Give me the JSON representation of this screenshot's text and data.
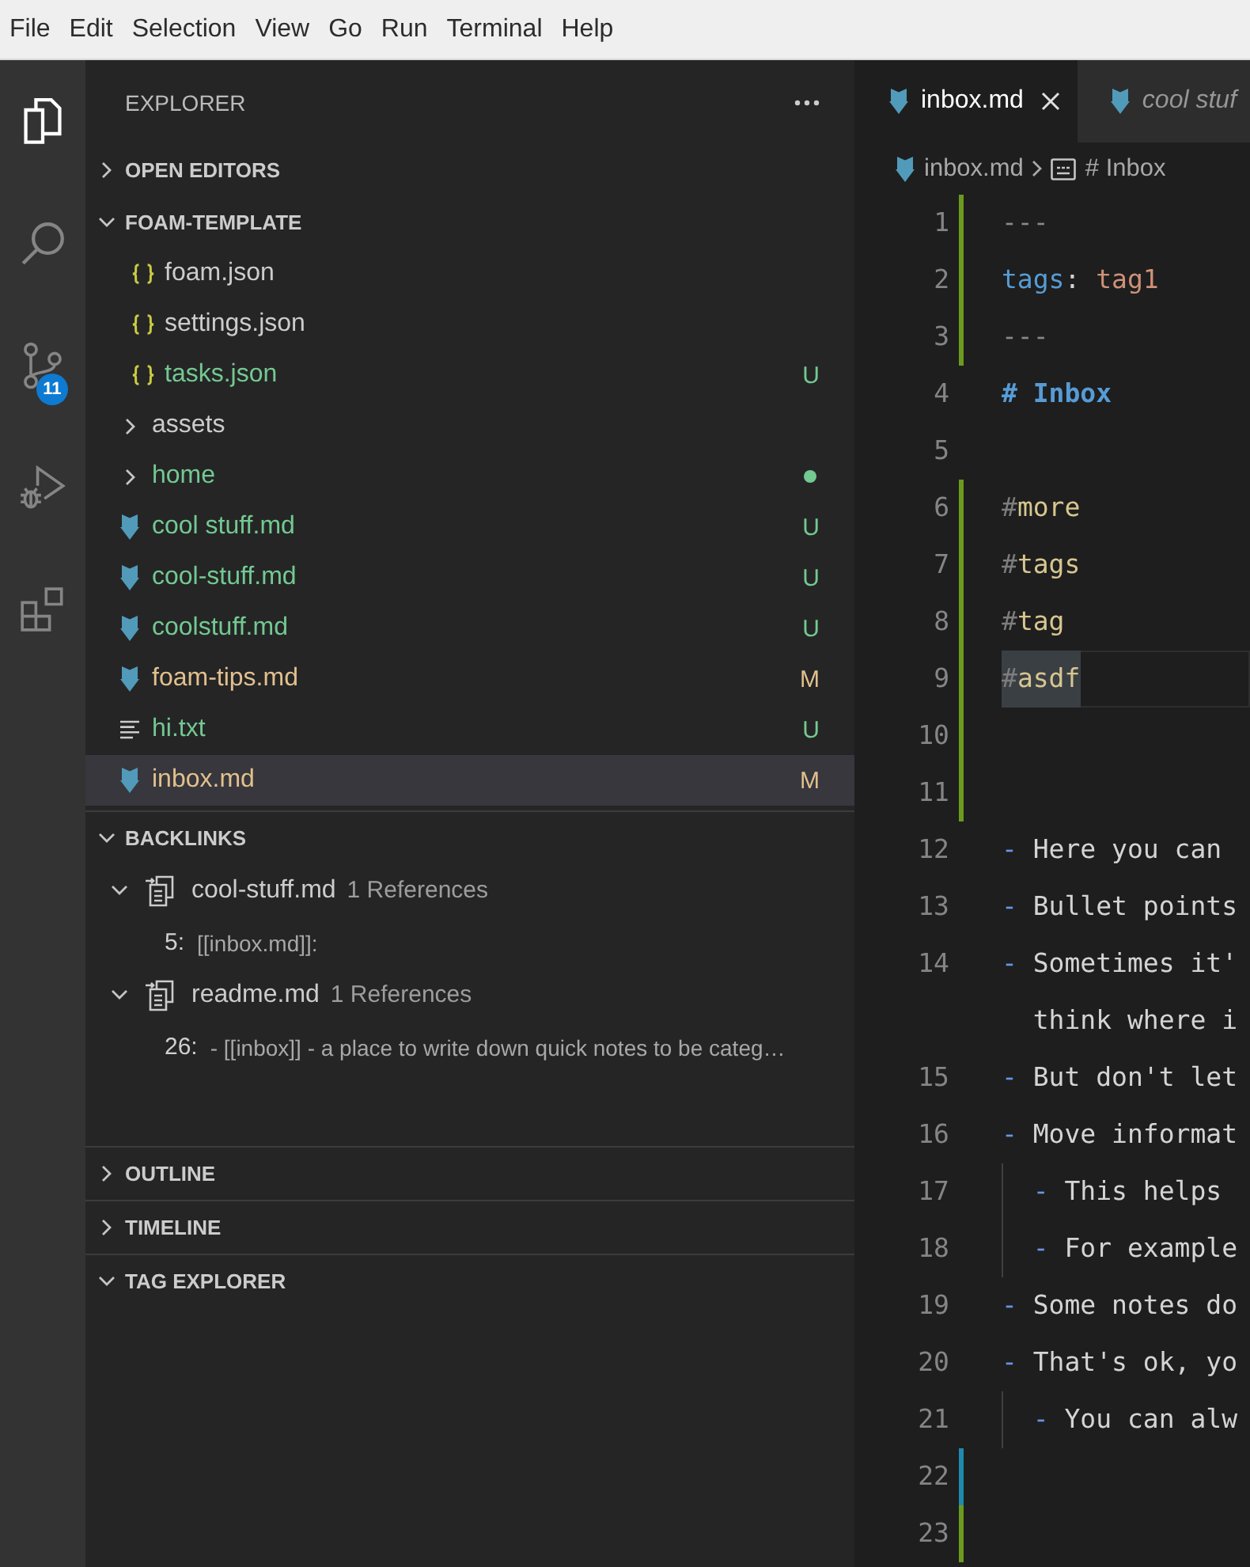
{
  "menu_bar": [
    "File",
    "Edit",
    "Selection",
    "View",
    "Go",
    "Run",
    "Terminal",
    "Help"
  ],
  "activity_bar": [
    {
      "kind": "explorer",
      "selected": true
    },
    {
      "kind": "search",
      "selected": false
    },
    {
      "kind": "source-control",
      "selected": false,
      "badge": "11"
    },
    {
      "kind": "run-debug",
      "selected": false
    },
    {
      "kind": "extensions",
      "selected": false
    }
  ],
  "sidebar": {
    "title": "EXPLORER",
    "sections": [
      {
        "kind": "open-editors",
        "title": "OPEN EDITORS",
        "expanded": false
      },
      {
        "kind": "files",
        "title": "FOAM-TEMPLATE",
        "expanded": true,
        "tree": [
          {
            "children": [
              {
                "name": "foam.json",
                "kind": "json",
                "selected": false
              },
              {
                "name": "settings.json",
                "kind": "json",
                "selected": false
              },
              {
                "name": "tasks.json",
                "kind": "json",
                "color": "#73c991",
                "badge": "U",
                "selected": false
              }
            ]
          },
          {
            "name": "assets",
            "kind": "folder",
            "expanded": false,
            "selected": false
          },
          {
            "name": "home",
            "kind": "folder",
            "expanded": false,
            "color": "#73c991",
            "dot": true,
            "selected": false
          },
          {
            "name": "cool stuff.md",
            "kind": "markdown",
            "color": "#73c991",
            "badge": "U",
            "selected": false
          },
          {
            "name": "cool-stuff.md",
            "kind": "markdown",
            "color": "#73c991",
            "badge": "U",
            "selected": false
          },
          {
            "name": "coolstuff.md",
            "kind": "markdown",
            "color": "#73c991",
            "badge": "U",
            "selected": false
          },
          {
            "name": "foam-tips.md",
            "kind": "markdown",
            "color": "#e2c08d",
            "badge": "M",
            "selected": false
          },
          {
            "name": "hi.txt",
            "kind": "text",
            "color": "#73c991",
            "badge": "U",
            "selected": false
          },
          {
            "name": "inbox.md",
            "kind": "markdown",
            "color": "#e2c08d",
            "badge": "M",
            "selected": true
          }
        ]
      },
      {
        "kind": "backlinks",
        "title": "BACKLINKS",
        "expanded": true,
        "items": [
          {
            "file": "cool-stuff.md",
            "count": "1 References",
            "expanded": true,
            "children": [
              {
                "line": "5:",
                "text": "[[inbox.md]]:"
              }
            ]
          },
          {
            "file": "readme.md",
            "count": "1 References",
            "expanded": true,
            "children": [
              {
                "line": "26:",
                "text": "- [[inbox]] - a place to write down quick notes to be categ…"
              }
            ]
          }
        ]
      },
      {
        "kind": "outline",
        "title": "OUTLINE",
        "expanded": false
      },
      {
        "kind": "timeline",
        "title": "TIMELINE",
        "expanded": false
      },
      {
        "kind": "tags",
        "title": "TAG EXPLORER",
        "expanded": true
      }
    ]
  },
  "editor": {
    "tabs": [
      {
        "title": "inbox.md",
        "kind": "markdown",
        "selected": true,
        "preview": false
      },
      {
        "title": "cool stuf",
        "kind": "markdown",
        "selected": false,
        "preview": true
      }
    ],
    "breadcrumb": [
      {
        "kind": "file",
        "text": "inbox.md"
      },
      {
        "kind": "symbol",
        "text": "# Inbox"
      }
    ],
    "lines": [
      {
        "number": "1",
        "color": "#6b9a1f",
        "current": false,
        "highlighted": false,
        "tokens": [
          {
            "kind": "punctuation",
            "text": "---"
          }
        ]
      },
      {
        "number": "2",
        "color": "#6b9a1f",
        "current": false,
        "highlighted": false,
        "tokens": [
          {
            "kind": "key",
            "text": "tags"
          },
          {
            "kind": "plain",
            "text": ": "
          },
          {
            "kind": "value",
            "text": "tag1"
          }
        ]
      },
      {
        "number": "3",
        "color": "#6b9a1f",
        "current": false,
        "highlighted": false,
        "tokens": [
          {
            "kind": "punctuation",
            "text": "---"
          }
        ]
      },
      {
        "number": "4",
        "current": false,
        "highlighted": false,
        "tokens": [
          {
            "kind": "heading",
            "text": "# Inbox"
          }
        ]
      },
      {
        "number": "5",
        "current": false
      },
      {
        "number": "6",
        "color": "#6b9a1f",
        "current": false,
        "highlighted": false,
        "tokens": [
          {
            "kind": "hash",
            "text": "#"
          },
          {
            "kind": "tag",
            "text": "more"
          }
        ]
      },
      {
        "number": "7",
        "color": "#6b9a1f",
        "current": false,
        "highlighted": false,
        "tokens": [
          {
            "kind": "hash",
            "text": "#"
          },
          {
            "kind": "tag",
            "text": "tags"
          }
        ]
      },
      {
        "number": "8",
        "color": "#6b9a1f",
        "current": false,
        "highlighted": false,
        "tokens": [
          {
            "kind": "hash",
            "text": "#"
          },
          {
            "kind": "tag",
            "text": "tag"
          }
        ]
      },
      {
        "number": "9",
        "color": "#6b9a1f",
        "current": true,
        "highlighted": true,
        "tokens": [
          {
            "kind": "hash",
            "text": "#"
          },
          {
            "kind": "tag",
            "text": "asdf"
          }
        ]
      },
      {
        "number": "10",
        "color": "#6b9a1f",
        "current": false
      },
      {
        "number": "11",
        "color": "#6b9a1f",
        "current": false
      },
      {
        "number": "12",
        "current": false,
        "highlighted": false,
        "tokens": [
          {
            "kind": "bullet",
            "text": "-"
          },
          {
            "kind": "plain",
            "text": " Here you can"
          }
        ]
      },
      {
        "number": "13",
        "current": false,
        "highlighted": false,
        "tokens": [
          {
            "kind": "bullet",
            "text": "-"
          },
          {
            "kind": "plain",
            "text": " Bullet points"
          }
        ]
      },
      {
        "number": "14",
        "current": false,
        "highlighted": false,
        "tokens": [
          {
            "kind": "bullet",
            "text": "-"
          },
          {
            "kind": "plain",
            "text": " Sometimes it'"
          }
        ],
        "wrap": "think where i"
      },
      {
        "number": "15",
        "current": false,
        "highlighted": false,
        "tokens": [
          {
            "kind": "bullet",
            "text": "-"
          },
          {
            "kind": "plain",
            "text": " But don't let"
          }
        ]
      },
      {
        "number": "16",
        "current": false,
        "highlighted": false,
        "tokens": [
          {
            "kind": "bullet",
            "text": "-"
          },
          {
            "kind": "plain",
            "text": " Move informat"
          }
        ]
      },
      {
        "number": "17",
        "current": false,
        "highlighted": false,
        "indent_guide": true,
        "tokens": [
          {
            "kind": "bullet",
            "text": "-"
          },
          {
            "kind": "plain",
            "text": " This helps"
          }
        ]
      },
      {
        "number": "18",
        "current": false,
        "highlighted": false,
        "indent_guide": true,
        "tokens": [
          {
            "kind": "bullet",
            "text": "-"
          },
          {
            "kind": "plain",
            "text": " For example"
          }
        ]
      },
      {
        "number": "19",
        "current": false,
        "highlighted": false,
        "tokens": [
          {
            "kind": "bullet",
            "text": "-"
          },
          {
            "kind": "plain",
            "text": " Some notes do"
          }
        ]
      },
      {
        "number": "20",
        "current": false,
        "highlighted": false,
        "tokens": [
          {
            "kind": "bullet",
            "text": "-"
          },
          {
            "kind": "plain",
            "text": " That's ok, yo"
          }
        ]
      },
      {
        "number": "21",
        "current": false,
        "highlighted": false,
        "indent_guide": true,
        "tokens": [
          {
            "kind": "bullet",
            "text": "-"
          },
          {
            "kind": "plain",
            "text": " You can alw"
          }
        ]
      },
      {
        "number": "22",
        "color": "#1f8ab0",
        "current": false
      },
      {
        "number": "23",
        "color": "#6b9a1f",
        "current": false
      }
    ]
  }
}
